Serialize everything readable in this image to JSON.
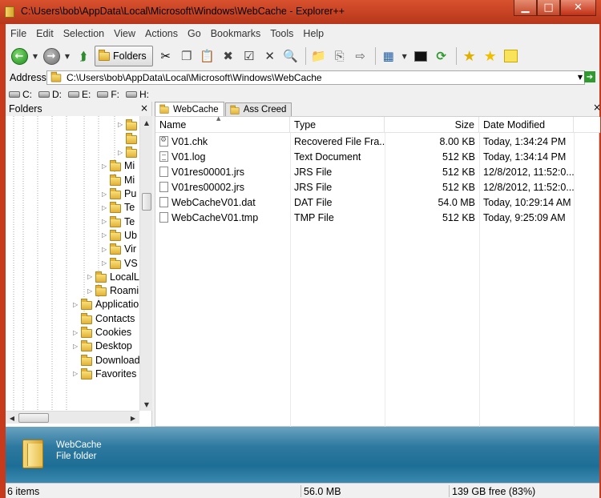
{
  "window": {
    "title": "C:\\Users\\bob\\AppData\\Local\\Microsoft\\Windows\\WebCache - Explorer++",
    "minimize": "▁",
    "maximize": "□",
    "close": "✕"
  },
  "menu": [
    "File",
    "Edit",
    "Selection",
    "View",
    "Actions",
    "Go",
    "Bookmarks",
    "Tools",
    "Help"
  ],
  "toolbar": {
    "folders_label": "Folders",
    "icons": [
      "back-icon",
      "forward-icon",
      "up-icon",
      "folders-icon",
      "cut-icon",
      "copy-icon",
      "paste-icon",
      "delete-icon",
      "properties-icon",
      "delete-permanently-icon",
      "search-icon",
      "new-folder-icon",
      "copy-to-icon",
      "move-to-icon",
      "views-icon",
      "command-prompt-icon",
      "refresh-icon",
      "add-bookmark-icon",
      "bookmarks-icon",
      "new-folder-yellow-icon"
    ]
  },
  "address": {
    "label": "Address",
    "value": "C:\\Users\\bob\\AppData\\Local\\Microsoft\\Windows\\WebCache"
  },
  "drives": [
    "C:",
    "D:",
    "E:",
    "F:",
    "H:"
  ],
  "folders_pane": {
    "title": "Folders",
    "close": "×",
    "tree": [
      {
        "label": "",
        "level": 6,
        "arrow": "▷"
      },
      {
        "label": "",
        "level": 6,
        "arrow": ""
      },
      {
        "label": "",
        "level": 6,
        "arrow": "▷"
      },
      {
        "label": "Mi",
        "level": 5,
        "arrow": "▷"
      },
      {
        "label": "Mi",
        "level": 5,
        "arrow": ""
      },
      {
        "label": "Pu",
        "level": 5,
        "arrow": "▷"
      },
      {
        "label": "Te",
        "level": 5,
        "arrow": "▷"
      },
      {
        "label": "Te",
        "level": 5,
        "arrow": "▷"
      },
      {
        "label": "Ub",
        "level": 5,
        "arrow": "▷"
      },
      {
        "label": "Vir",
        "level": 5,
        "arrow": "▷"
      },
      {
        "label": "VS",
        "level": 5,
        "arrow": "▷"
      },
      {
        "label": "LocalL",
        "level": 4,
        "arrow": "▷"
      },
      {
        "label": "Roami",
        "level": 4,
        "arrow": "▷"
      },
      {
        "label": "Applicatio",
        "level": 3,
        "arrow": "▷"
      },
      {
        "label": "Contacts",
        "level": 3,
        "arrow": ""
      },
      {
        "label": "Cookies",
        "level": 3,
        "arrow": "▷"
      },
      {
        "label": "Desktop",
        "level": 3,
        "arrow": "▷"
      },
      {
        "label": "Download",
        "level": 3,
        "arrow": ""
      },
      {
        "label": "Favorites",
        "level": 3,
        "arrow": "▷"
      }
    ]
  },
  "tabs": [
    {
      "label": "WebCache",
      "active": true
    },
    {
      "label": "Ass Creed",
      "active": false
    }
  ],
  "tabs_close": "×",
  "files": {
    "columns": [
      "Name",
      "Type",
      "Size",
      "Date Modified"
    ],
    "rows": [
      {
        "name": "V01.chk",
        "type": "Recovered File Fra...",
        "size": "8.00 KB",
        "date": "Today, 1:34:24 PM",
        "icon": "gear"
      },
      {
        "name": "V01.log",
        "type": "Text Document",
        "size": "512 KB",
        "date": "Today, 1:34:14 PM",
        "icon": "txt"
      },
      {
        "name": "V01res00001.jrs",
        "type": "JRS File",
        "size": "512 KB",
        "date": "12/8/2012, 11:52:0...",
        "icon": "blank"
      },
      {
        "name": "V01res00002.jrs",
        "type": "JRS File",
        "size": "512 KB",
        "date": "12/8/2012, 11:52:0...",
        "icon": "blank"
      },
      {
        "name": "WebCacheV01.dat",
        "type": "DAT File",
        "size": "54.0 MB",
        "date": "Today, 10:29:14 AM",
        "icon": "blank"
      },
      {
        "name": "WebCacheV01.tmp",
        "type": "TMP File",
        "size": "512 KB",
        "date": "Today, 9:25:09 AM",
        "icon": "blank"
      }
    ]
  },
  "preview": {
    "name": "WebCache",
    "type": "File folder"
  },
  "status": {
    "items": "6 items",
    "size": "56.0 MB",
    "free": "139 GB free (83%)"
  }
}
